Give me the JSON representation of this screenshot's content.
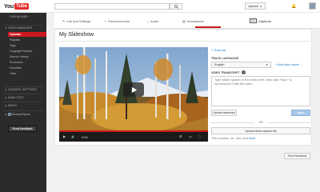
{
  "header": {
    "logo_you": "You",
    "logo_tube": "Tube",
    "upload_label": "Upload"
  },
  "sidebar": {
    "dashboard": "DASHBOARD",
    "video_manager": "VIDEO MANAGER",
    "items": [
      "Uploads",
      "Playlists",
      "Tags",
      "Copyright Notices",
      "Search History",
      "Purchases",
      "Favorites",
      "Likes"
    ],
    "channel_settings": "CHANNEL SETTINGS",
    "analytics": "ANALYTICS",
    "inbox": "INBOX",
    "user_name": "Richard Byrne",
    "send_feedback": "Send feedback"
  },
  "tabs": [
    {
      "label": "Info and Settings",
      "icon": "pencil-icon"
    },
    {
      "label": "Enhancements",
      "icon": "wand-icon"
    },
    {
      "label": "Audio",
      "icon": "music-note-icon"
    },
    {
      "label": "Annotations",
      "icon": "annotation-icon"
    },
    {
      "label": "Captions",
      "icon": "captions-icon",
      "active": true
    }
  ],
  "video": {
    "title": "My Slideshow",
    "time": "0:00"
  },
  "captions": {
    "back_link": "« Track list",
    "track_language_label": "TRACK LANGUAGE",
    "language_value": "English",
    "add_track_name": "+ Add track name",
    "transcript_label": "VIDEO TRANSCRIPT",
    "transcript_placeholder": "Type what's spoken in the video here, then click \"Sync\" to synchronize it with the video.",
    "upload_transcript": "Upload transcript",
    "sync": "Sync",
    "or": "OR",
    "upload_caption_file": "Upload timed caption file",
    "beta_note": "This includes .srt, .sbv, and ",
    "beta_link": "more"
  },
  "footer": {
    "send_feedback": "Send feedback"
  },
  "colors": {
    "brand_red": "#cc181e",
    "link_blue": "#167ac6",
    "sidebar_bg": "#2b2b2b"
  }
}
